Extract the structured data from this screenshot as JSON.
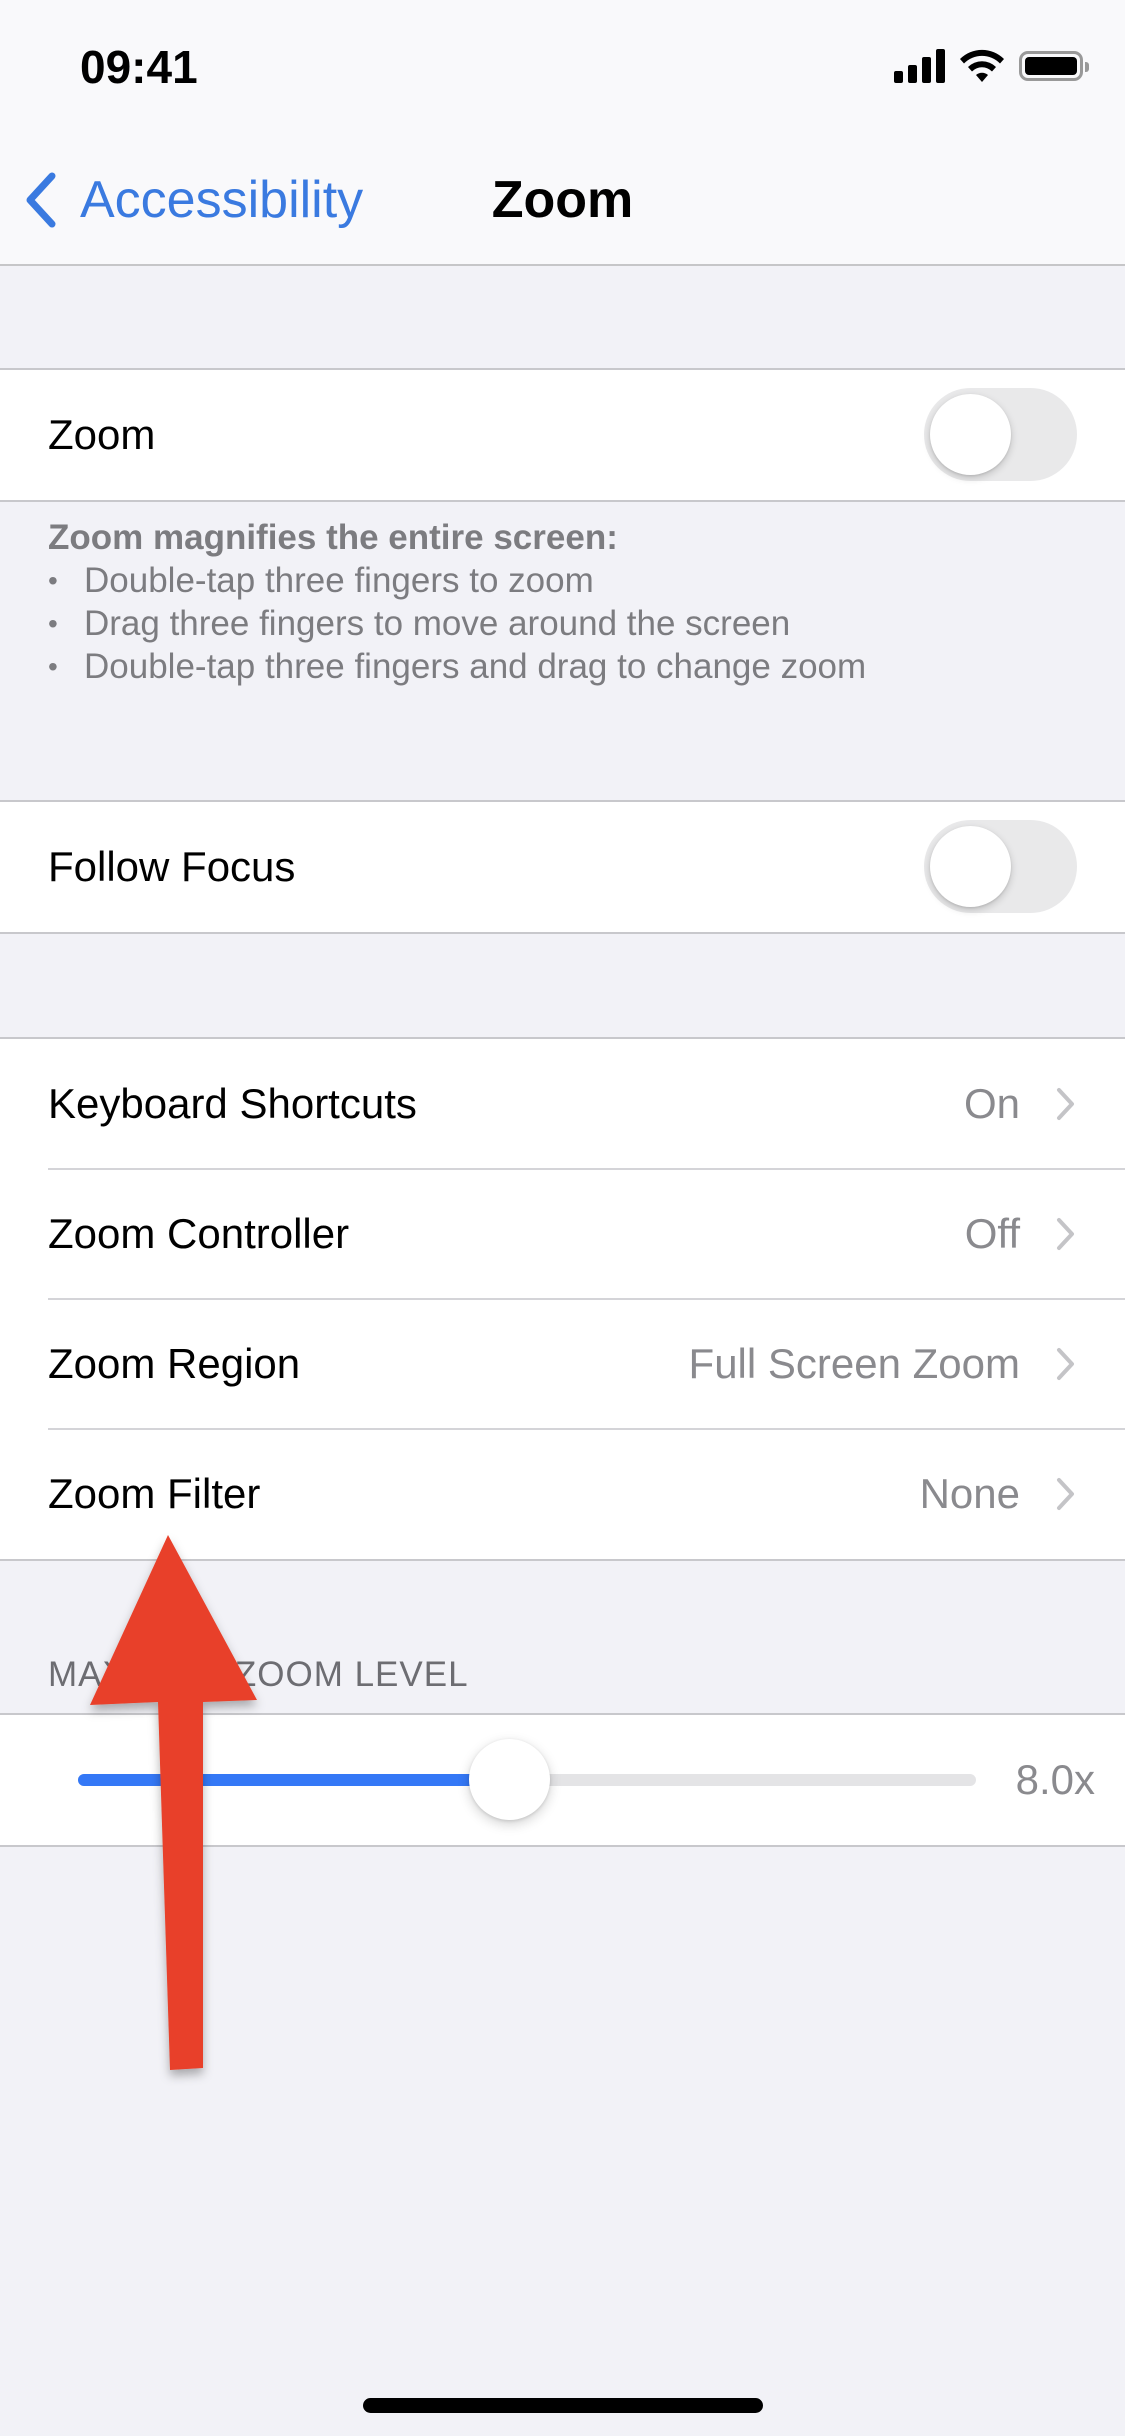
{
  "status_bar": {
    "time": "09:41",
    "icons": [
      "cellular-signal-icon",
      "wifi-icon",
      "battery-icon"
    ]
  },
  "nav": {
    "back_label": "Accessibility",
    "back_icon": "chevron-left-icon",
    "title": "Zoom"
  },
  "zoom_group": {
    "label": "Zoom",
    "enabled": false
  },
  "zoom_footer": {
    "title": "Zoom magnifies the entire screen:",
    "bullets": [
      "Double-tap three fingers to zoom",
      "Drag three fingers to move around the screen",
      "Double-tap three fingers and drag to change zoom"
    ]
  },
  "follow_focus": {
    "label": "Follow Focus",
    "enabled": false
  },
  "options": [
    {
      "label": "Keyboard Shortcuts",
      "value": "On"
    },
    {
      "label": "Zoom Controller",
      "value": "Off"
    },
    {
      "label": "Zoom Region",
      "value": "Full Screen Zoom"
    },
    {
      "label": "Zoom Filter",
      "value": "None"
    }
  ],
  "max_zoom": {
    "header": "MAXIMUM ZOOM LEVEL",
    "value_label": "8.0x",
    "slider_fraction": 0.48
  },
  "annotation": {
    "type": "red-arrow-pointing-up",
    "target": "Zoom Filter",
    "color": "#e8402a"
  },
  "colors": {
    "accent": "#3a7ae0",
    "slider_fill": "#3478f6",
    "background": "#f2f2f7",
    "secondary_text": "#8a8a8e"
  }
}
